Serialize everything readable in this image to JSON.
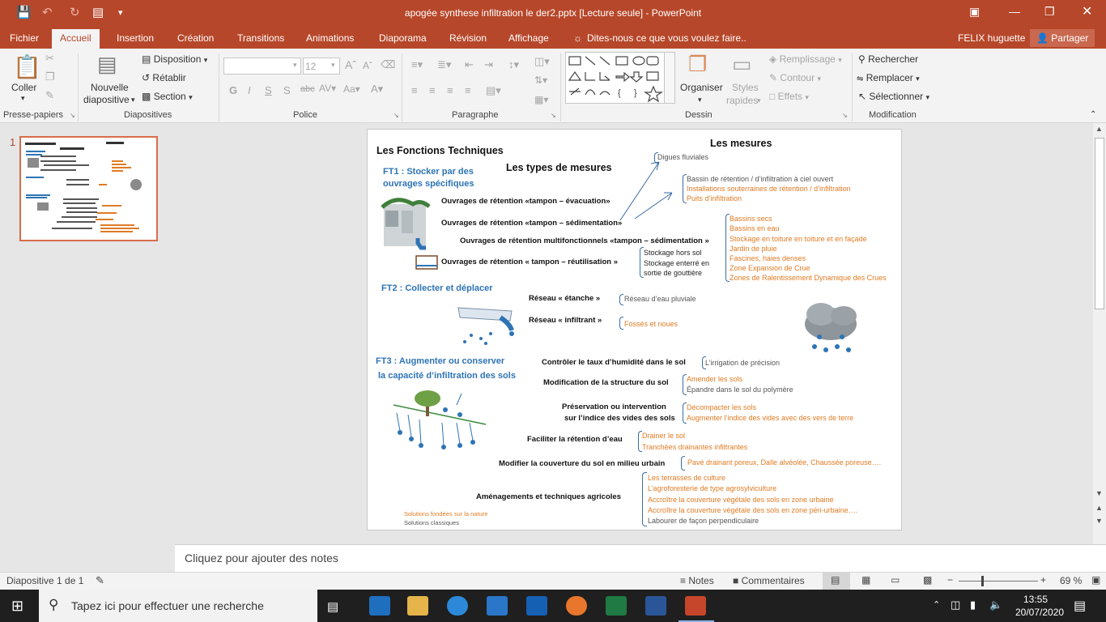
{
  "window": {
    "title": "apogée synthese infiltration le der2.pptx [Lecture seule] - PowerPoint",
    "user": "FELIX huguette",
    "share": "Partager"
  },
  "tabs": [
    "Fichier",
    "Accueil",
    "Insertion",
    "Création",
    "Transitions",
    "Animations",
    "Diaporama",
    "Révision",
    "Affichage"
  ],
  "tellme": "Dites-nous ce que vous voulez faire..",
  "ribbon": {
    "clipboard": {
      "paste": "Coller",
      "group": "Presse-papiers"
    },
    "slides": {
      "new1": "Nouvelle",
      "new2": "diapositive",
      "layout": "Disposition",
      "reset": "Rétablir",
      "section": "Section",
      "group": "Diapositives"
    },
    "font": {
      "size": "12",
      "group": "Police"
    },
    "paragraph": {
      "group": "Paragraphe"
    },
    "drawing": {
      "arrange": "Organiser",
      "styles1": "Styles",
      "styles2": "rapides",
      "fill": "Remplissage",
      "outline": "Contour",
      "effects": "Effets",
      "group": "Dessin"
    },
    "editing": {
      "find": "Rechercher",
      "replace": "Remplacer",
      "select": "Sélectionner",
      "group": "Modification"
    }
  },
  "thumb": {
    "number": "1"
  },
  "slide": {
    "main_title": "Les Fonctions Techniques",
    "types_title": "Les types de mesures",
    "mesures_title": "Les mesures",
    "ft1a": "FT1 : Stocker par des",
    "ft1b": "ouvrages spécifiques",
    "o1": "Ouvrages de rétention  «tampon – évacuation»",
    "o2": "Ouvrages de rétention  «tampon – sédimentation»",
    "o3": "Ouvrages de rétention multifonctionnels «tampon – sédimentation »",
    "o4": "Ouvrages de rétention  « tampon – réutilisation »",
    "m_digues": "Digues fluviales",
    "m_bassin": "Bassin de rétention / d’infiltration à ciel ouvert",
    "m_instal": "Installations souterraines de rétention / d’infiltration",
    "m_puits": "Puits d’infiltration",
    "m_multi": [
      "Bassins secs",
      "Bassins en eau",
      "Stockage en toiture en toiture et en façade",
      "Jardin de pluie",
      "Fascines, haies denses",
      "Zone Expansion de Crue",
      "Zones de Ralentissement Dynamique des Crues"
    ],
    "m_reuse": [
      "Stockage hors sol",
      "Stockage enterré en",
      "sortie de gouttière"
    ],
    "ft2": "FT2 : Collecter et déplacer",
    "r1": "Réseau « étanche »",
    "r1m": "Réseau d’eau pluviale",
    "r2": "Réseau « infiltrant »",
    "r2m": "Fossés et noues",
    "ft3a": "FT3 : Augmenter ou conserver",
    "ft3b": "la capacité d’infiltration des sols",
    "c1": "Contrôler le taux d’humidité dans le sol",
    "c1m": "L’irrigation de précision",
    "c2": "Modification de la structure du sol",
    "c2m1": "Amender les sols",
    "c2m2": "Épandre dans le sol du polymère",
    "c3a": "Préservation ou intervention",
    "c3b": "sur l’indice des vides des sols",
    "c3m1": "Décompacter les sols",
    "c3m2": "Augmenter l’indice des vides avec des vers de terre",
    "c4": "Faciliter la rétention d’eau",
    "c4m1": "Drainer le sol",
    "c4m2": "Tranchées drainantes infiltrantes",
    "c5": "Modifier la couverture du sol en milieu urbain",
    "c5m": "Pavé drainant poreux, Dalle alvéolée, Chaussée poreuse….",
    "c6": "Aménagements  et techniques agricoles",
    "c6m": [
      "Les terrasses de culture",
      "L’agroforesterie de type agrosylviculture",
      "Accroître la couverture végétale des sols en zone urbaine",
      "Accroître la couverture végétale des sols en zone péri-urbaine….",
      "Labourer de façon perpendiculaire"
    ],
    "leg1": "Solutions fondées sur la nature",
    "leg2": "Solutions classiques"
  },
  "notes": "Cliquez pour ajouter des notes",
  "status": {
    "slide": "Diapositive 1 de 1",
    "notes": "Notes",
    "comments": "Commentaires",
    "zoom": "69 %"
  },
  "taskbar": {
    "search": "Tapez ici pour effectuer une recherche",
    "time": "13:55",
    "date": "20/07/2020"
  },
  "colors": {
    "accent": "#b7472a",
    "orange": "#e07b24",
    "blue": "#2e74b5"
  }
}
